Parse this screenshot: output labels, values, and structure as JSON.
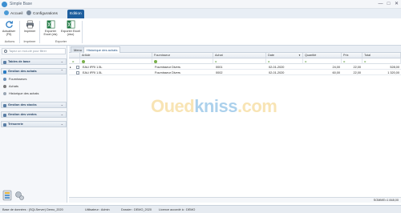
{
  "window": {
    "title": "Simple Base",
    "controls": [
      "—",
      "□",
      "✕"
    ]
  },
  "ribbon_tabs": [
    {
      "label": "Accueil",
      "icon": "home-icon",
      "active": false
    },
    {
      "label": "Configurations",
      "icon": "gear-icon",
      "active": false
    },
    {
      "label": "Edition",
      "icon": "",
      "active": true
    }
  ],
  "ribbon": {
    "buttons": [
      {
        "label": "Actualiser (F5)",
        "icon": "refresh-icon"
      },
      {
        "label": "Imprimer",
        "icon": "printer-icon"
      },
      {
        "label": "Exporter Excel (xls)",
        "icon": "excel-export-icon"
      },
      {
        "label": "Exporter Excel (xlsx)",
        "icon": "excel-export-icon"
      }
    ],
    "groups": [
      "Actions",
      "Imprimer",
      "Exporter"
    ]
  },
  "sidebar": {
    "search_placeholder": "Tapez un mot-clé pour filtrer",
    "groups": [
      {
        "label": "Tables de base",
        "expanded": false
      },
      {
        "label": "Gestion des achats",
        "expanded": true,
        "items": [
          "Fournisseurs",
          "Achats",
          "Historique des achats"
        ]
      },
      {
        "label": "Gestion des stocks",
        "expanded": false
      },
      {
        "label": "Gestion des ventes",
        "expanded": false
      },
      {
        "label": "Trésorerie",
        "expanded": false
      }
    ]
  },
  "doc_tabs": [
    {
      "label": "Menu",
      "active": false
    },
    {
      "label": "Historique des achats",
      "active": true
    }
  ],
  "grid": {
    "columns": [
      "Article",
      "Fournisseur",
      "Achat",
      "Date",
      "Quantité",
      "Prix",
      "Total"
    ],
    "rows": [
      {
        "article": "EAU IFRI 1.5L",
        "fournisseur": "Fournisseur Divers",
        "achat": "0001",
        "date": "02-01-2020",
        "quantite": "24,00",
        "prix": "22,00",
        "total": "528,00"
      },
      {
        "article": "EAU IFRI 1.5L",
        "fournisseur": "Fournisseur Divers",
        "achat": "0002",
        "date": "02-01-2020",
        "quantite": "60,00",
        "prix": "22,00",
        "total": "1 320,00"
      }
    ],
    "summary": "SOMME=1 848,00"
  },
  "watermark": {
    "part1": "Oued",
    "part2": "kniss",
    "part3": ".com"
  },
  "statusbar": {
    "database": "Base de données : (SQLServer) Demo_2020",
    "user": "Utilisateur : Admin",
    "folder": "Dossier : DEMO_2020",
    "license": "Licence accordé à : DEMO"
  },
  "colors": {
    "accent": "#1f5f9e",
    "sidebar_bg": "#f5f7fa",
    "header_group": "#1e3c5e"
  }
}
